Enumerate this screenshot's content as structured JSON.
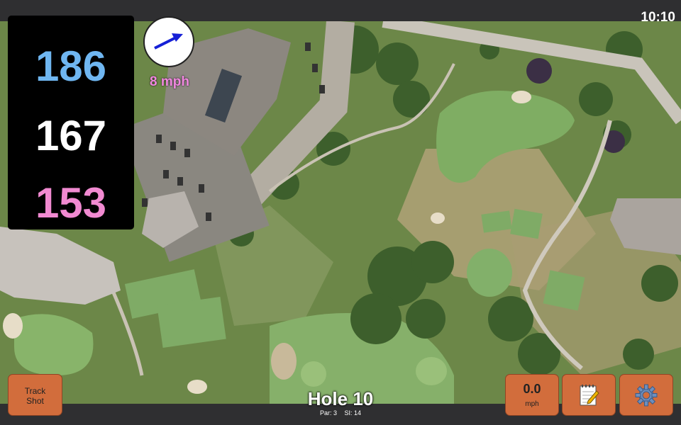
{
  "status": {
    "time": "10:10"
  },
  "yardages": {
    "back": "186",
    "middle": "167",
    "front": "153"
  },
  "wind": {
    "speed": "8 mph",
    "direction_icon": "arrow-icon"
  },
  "buttons": {
    "track_shot": "Track Shot",
    "speed_value": "0.0",
    "speed_unit": "mph",
    "notes_icon": "notepad-icon",
    "settings_icon": "gear-icon"
  },
  "hole": {
    "title": "Hole 10",
    "par": "Par: 3",
    "si": "SI: 14"
  },
  "colors": {
    "back": "#6fb6f1",
    "middle": "#ffffff",
    "front": "#f18ad1",
    "button": "#d26d3c",
    "wind_text": "#f187e0"
  }
}
